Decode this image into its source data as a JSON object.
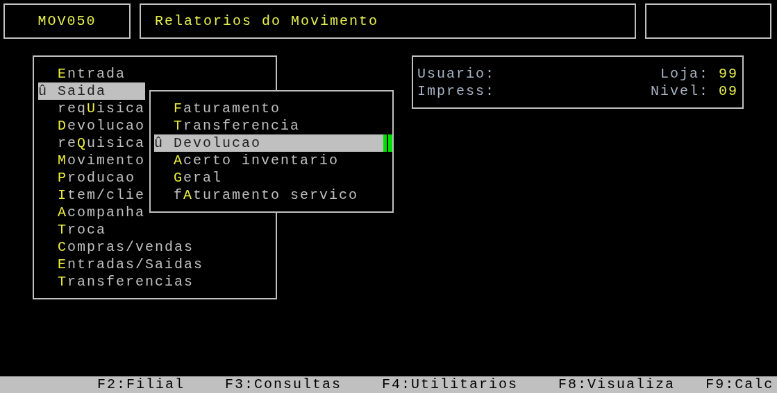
{
  "header": {
    "program_code": "MOV050",
    "title": "Relatorios do Movimento"
  },
  "main_menu": {
    "marker": "û",
    "items": [
      {
        "hotkey": "E",
        "suffix": "ntrada",
        "selected": false
      },
      {
        "hotkey": "S",
        "suffix": "aida",
        "selected": true
      },
      {
        "prefix": "req",
        "hotkey": "U",
        "suffix": "isica",
        "selected": false
      },
      {
        "hotkey": "D",
        "suffix": "evolucao",
        "selected": false
      },
      {
        "prefix": "re",
        "hotkey": "Q",
        "suffix": "uisica",
        "selected": false
      },
      {
        "hotkey": "M",
        "suffix": "ovimento",
        "selected": false
      },
      {
        "hotkey": "P",
        "suffix": "roducao",
        "selected": false
      },
      {
        "hotkey": "I",
        "suffix": "tem/clie",
        "selected": false
      },
      {
        "hotkey": "A",
        "suffix": "companha",
        "selected": false
      },
      {
        "hotkey": "T",
        "suffix": "roca",
        "selected": false
      },
      {
        "hotkey": "C",
        "suffix": "ompras/vendas",
        "selected": false
      },
      {
        "hotkey": "E",
        "suffix": "ntradas/Saidas",
        "selected": false
      },
      {
        "hotkey": "T",
        "suffix": "ransferencias",
        "selected": false
      }
    ]
  },
  "submenu": {
    "marker": "û",
    "items": [
      {
        "hotkey": "F",
        "suffix": "aturamento",
        "selected": false
      },
      {
        "hotkey": "T",
        "suffix": "ransferencia",
        "selected": false
      },
      {
        "hotkey": "D",
        "suffix": "evolucao",
        "selected": true
      },
      {
        "hotkey": "A",
        "suffix": "certo inventario",
        "selected": false
      },
      {
        "hotkey": "G",
        "suffix": "eral",
        "selected": false
      },
      {
        "prefix": "f",
        "hotkey": "A",
        "suffix": "turamento servico",
        "selected": false
      }
    ]
  },
  "info": {
    "rows": [
      {
        "label": "Usuario:",
        "right_label": "Loja:",
        "right_value": "99"
      },
      {
        "label": "Impress:",
        "right_label": "Nivel:",
        "right_value": "09"
      }
    ]
  },
  "function_keys": [
    "F2:Filial",
    "F3:Consultas",
    "F4:Utilitarios",
    "F8:Visualiza",
    "F9:Calc"
  ]
}
